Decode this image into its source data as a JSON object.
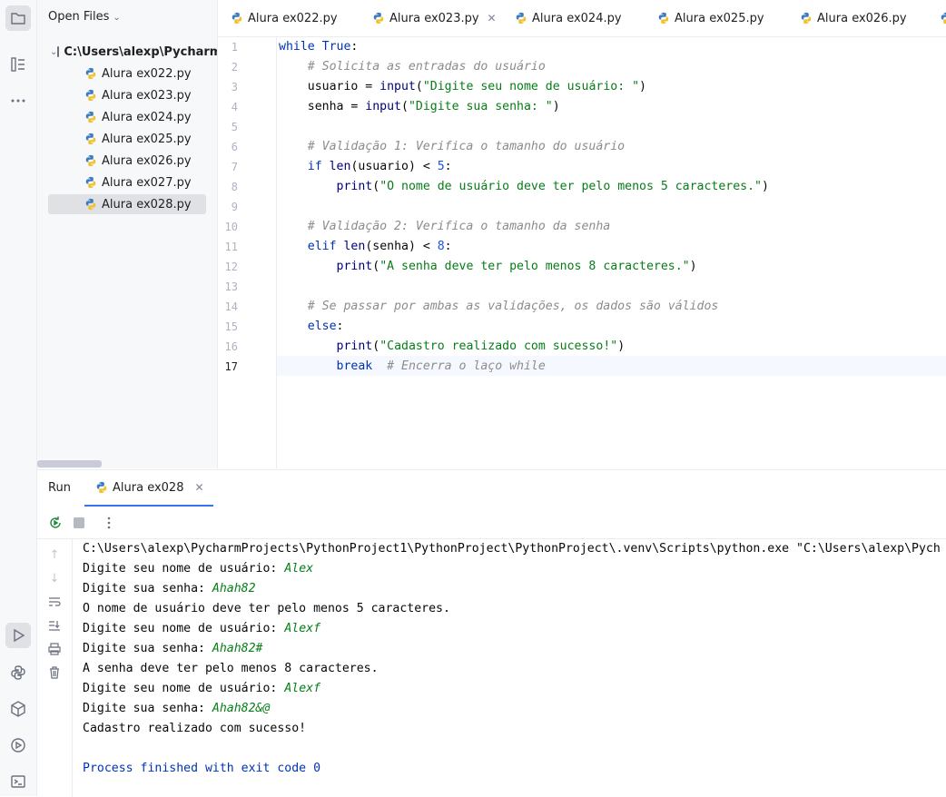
{
  "project_panel": {
    "header": "Open Files",
    "root_folder": "C:\\Users\\alexp\\Pycharm",
    "files": [
      "Alura ex022.py",
      "Alura ex023.py",
      "Alura ex024.py",
      "Alura ex025.py",
      "Alura ex026.py",
      "Alura ex027.py",
      "Alura ex028.py"
    ],
    "selected_file": "Alura ex028.py"
  },
  "editor_tabs": [
    {
      "label": "Alura ex022.py",
      "active": false
    },
    {
      "label": "Alura ex023.py",
      "active": true
    },
    {
      "label": "Alura ex024.py",
      "active": false
    },
    {
      "label": "Alura ex025.py",
      "active": false
    },
    {
      "label": "Alura ex026.py",
      "active": false
    }
  ],
  "editor": {
    "line_numbers": [
      "1",
      "2",
      "3",
      "4",
      "5",
      "6",
      "7",
      "8",
      "9",
      "10",
      "11",
      "12",
      "13",
      "14",
      "15",
      "16",
      "17"
    ],
    "current_line": "17",
    "code": {
      "l1_kw": "while",
      "l1_true": "True",
      "l1_colon": ":",
      "l2": "# Solicita as entradas do usuário",
      "l3_a": "usuario = ",
      "l3_fn": "input",
      "l3_p1": "(",
      "l3_str": "\"Digite seu nome de usuário: \"",
      "l3_p2": ")",
      "l4_a": "senha = ",
      "l4_fn": "input",
      "l4_p1": "(",
      "l4_str": "\"Digite sua senha: \"",
      "l4_p2": ")",
      "l6": "# Validação 1: Verifica o tamanho do usuário",
      "l7_kw": "if",
      "l7_fn": "len",
      "l7_a": "(usuario) < ",
      "l7_num": "5",
      "l7_b": ":",
      "l8_fn": "print",
      "l8_p1": "(",
      "l8_str": "\"O nome de usuário deve ter pelo menos 5 caracteres.\"",
      "l8_p2": ")",
      "l10": "# Validação 2: Verifica o tamanho da senha",
      "l11_kw": "elif",
      "l11_fn": "len",
      "l11_a": "(senha) < ",
      "l11_num": "8",
      "l11_b": ":",
      "l12_fn": "print",
      "l12_p1": "(",
      "l12_str": "\"A senha deve ter pelo menos 8 caracteres.\"",
      "l12_p2": ")",
      "l14": "# Se passar por ambas as validações, os dados são válidos",
      "l15_kw": "else",
      "l15_b": ":",
      "l16_fn": "print",
      "l16_p1": "(",
      "l16_str": "\"Cadastro realizado com sucesso!\"",
      "l16_p2": ")",
      "l17_kw": "break",
      "l17_cm": "# Encerra o laço while"
    }
  },
  "run_panel": {
    "title": "Run",
    "tab_label": "Alura ex028",
    "console": {
      "cmd": "C:\\Users\\alexp\\PycharmProjects\\PythonProject1\\PythonProject\\PythonProject\\.venv\\Scripts\\python.exe \"C:\\Users\\alexp\\Pych",
      "p1": "Digite seu nome de usuário: ",
      "i1": "Alex",
      "p2": "Digite sua senha: ",
      "i2": "Ahah82",
      "o1": "O nome de usuário deve ter pelo menos 5 caracteres.",
      "p3": "Digite seu nome de usuário: ",
      "i3": "Alexf",
      "p4": "Digite sua senha: ",
      "i4": "Ahah82#",
      "o2": "A senha deve ter pelo menos 8 caracteres.",
      "p5": "Digite seu nome de usuário: ",
      "i5": "Alexf",
      "p6": "Digite sua senha: ",
      "i6": "Ahah82&@",
      "o3": "Cadastro realizado com sucesso!",
      "exit": "Process finished with exit code 0"
    }
  },
  "colors": {
    "accent": "#3574f0",
    "keyword": "#0033b3",
    "string": "#067d17",
    "number": "#1750eb",
    "comment": "#8c8c8c"
  }
}
